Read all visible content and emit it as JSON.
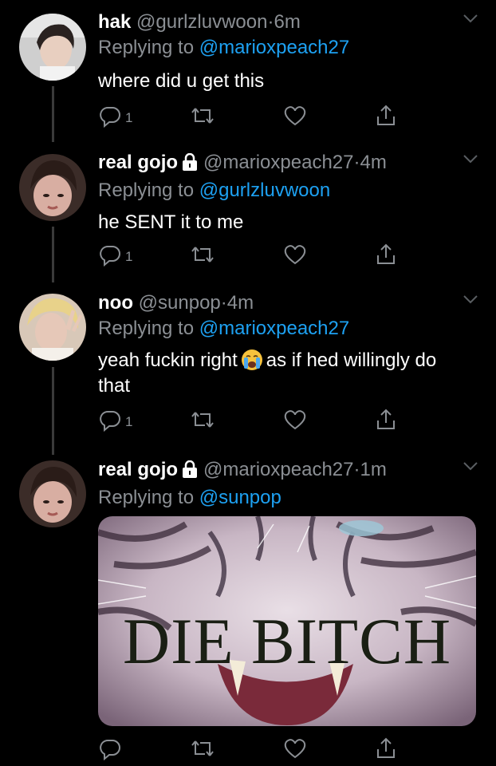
{
  "tweets": [
    {
      "name": "hak",
      "handle": "@gurlzluvwoon",
      "separator": "·",
      "time": "6m",
      "replying_prefix": "Replying to",
      "replying_to": "@marioxpeach27",
      "text": "where did u get this",
      "reply_count": "1",
      "locked": false
    },
    {
      "name": "real gojo",
      "handle": "@marioxpeach27",
      "separator": "·",
      "time": "4m",
      "replying_prefix": "Replying to",
      "replying_to": "@gurlzluvwoon",
      "text": "he SENT it to me",
      "reply_count": "1",
      "locked": true
    },
    {
      "name": "noo",
      "handle": "@sunpop",
      "separator": "·",
      "time": "4m",
      "replying_prefix": "Replying to",
      "replying_to": "@marioxpeach27",
      "text_before_emoji": "yeah fuckin right",
      "emoji": "loudly-crying-face",
      "text_after_emoji": "as if hed willingly do that",
      "reply_count": "1",
      "locked": false
    },
    {
      "name": "real gojo",
      "handle": "@marioxpeach27",
      "separator": "·",
      "time": "1m",
      "replying_prefix": "Replying to",
      "replying_to": "@sunpop",
      "media_caption": "DIE BITCH",
      "locked": true
    }
  ],
  "icons": {
    "reply": "reply-icon",
    "retweet": "retweet-icon",
    "like": "heart-icon",
    "share": "share-icon",
    "caret": "chevron-down-icon",
    "lock": "lock-icon"
  },
  "colors": {
    "background": "#000000",
    "text": "#ffffff",
    "secondary": "#8b8f94",
    "mention": "#1da1f2",
    "thread_line": "#3a3a3a"
  }
}
